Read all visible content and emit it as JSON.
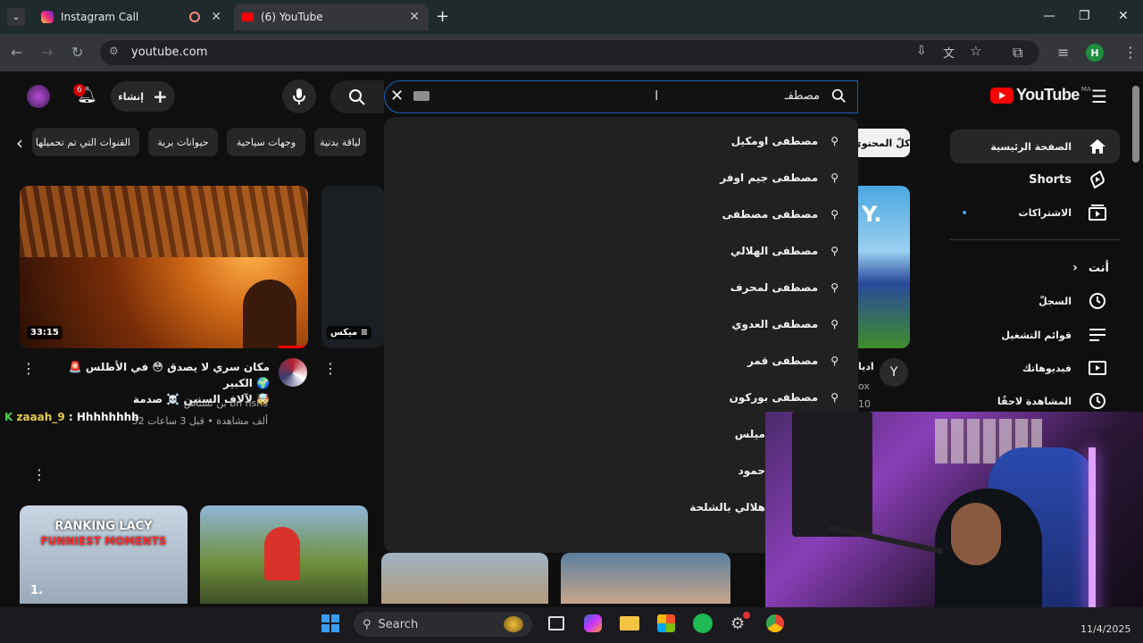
{
  "browser": {
    "tabs": [
      {
        "title": "Instagram Call",
        "icon": "instagram-icon"
      },
      {
        "title": "(6) YouTube",
        "icon": "youtube-icon"
      }
    ],
    "url": "youtube.com",
    "profile_initial": "H"
  },
  "youtube": {
    "logo_text": "YouTube",
    "logo_region": "MA",
    "create_label": "إنشاء",
    "notifications_count": "6",
    "search_value": "مصطفـ",
    "chips": [
      "كلّ المحتوى",
      "لياقة بدنية",
      "وجهات سياحية",
      "حيوانات برية",
      "القنوات التي تم تحميلها مؤ"
    ],
    "suggestions": [
      "مصطفى اومكيل",
      "مصطفى جيم اوفر",
      "مصطفى مصطفى",
      "مصطفى الهلالي",
      "مصطفى لمحرف",
      "مصطفى العدوي",
      "مصطفى قمر",
      "مصطفى بوركون",
      "ميلس",
      "حمود",
      "هلالي بالشلحة"
    ],
    "sidebar": {
      "items": [
        {
          "label": "الصفحة الرئيسية",
          "icon": "home-icon"
        },
        {
          "label": "Shorts",
          "icon": "shorts-icon"
        },
        {
          "label": "الاشتراكات",
          "icon": "subscriptions-icon"
        }
      ],
      "you_label": "أنت",
      "you_items": [
        {
          "label": "السجلّ",
          "icon": "history-icon"
        },
        {
          "label": "قوائم التشغيل",
          "icon": "playlists-icon"
        },
        {
          "label": "فيديوهاتك",
          "icon": "your-videos-icon"
        },
        {
          "label": "المشاهدة لاحقًا",
          "icon": "watch-later-icon"
        }
      ]
    },
    "videos": [
      {
        "title_line1": "🚨 مكان سري لا يصدق 😳 في الأطلس الكبير 🌍",
        "title_line2": "لآلاف السنين ☠️ صدمة 🤯",
        "channel": "بن نسناس bn nsns",
        "meta": "32 ألف مشاهدة • قبل 3 ساعات",
        "duration": "33:15"
      },
      {
        "badge": "ميكس"
      }
    ],
    "partial_right": {
      "line1": "اديا",
      "line2": "ox",
      "line3": "10"
    },
    "chat_overlay": {
      "user": "zaaah_9",
      "message": "Hhhhhhhh"
    },
    "bottom_thumbs": [
      {
        "text_line1": "RANKING LACY",
        "text_line2": "FUNNIEST MOMENTS",
        "number": "1."
      }
    ]
  },
  "taskbar": {
    "search_label": "Search",
    "date": "11/4/2025"
  }
}
